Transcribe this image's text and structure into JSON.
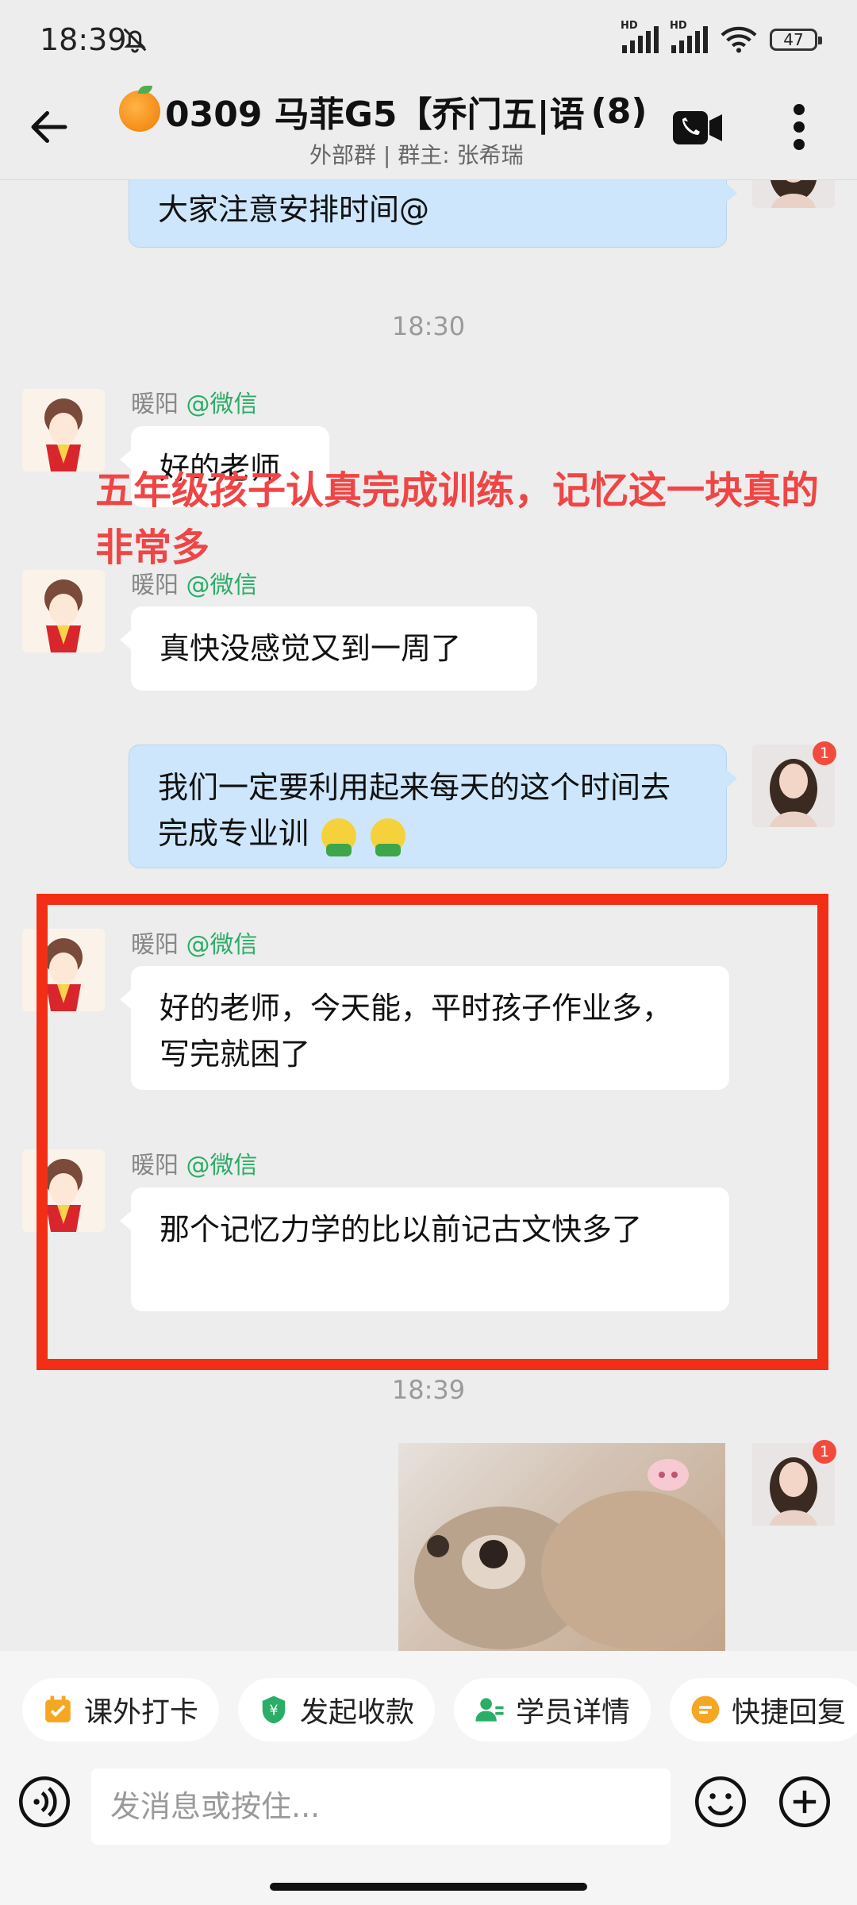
{
  "status_bar": {
    "time": "18:39",
    "battery": "47",
    "network_tag": "HD"
  },
  "header": {
    "title": "0309 马菲G5【乔门五|语",
    "member_count": "(8)",
    "subtitle": "外部群 | 群主: 张希瑞"
  },
  "messages": {
    "m0": {
      "text": "大家注意安排时间@"
    },
    "t1": "18:30",
    "m1": {
      "sender": "暖阳",
      "source": "@微信",
      "text": "好的老师"
    },
    "m2": {
      "sender": "暖阳",
      "source": "@微信",
      "text": "真快没感觉又到一周了"
    },
    "m3": {
      "text": "我们一定要利用起来每天的这个时间去完成专业训"
    },
    "m4": {
      "sender": "暖阳",
      "source": "@微信",
      "text": "好的老师，今天能，平时孩子作业多，写完就困了"
    },
    "m5": {
      "sender": "暖阳",
      "source": "@微信",
      "text": "那个记忆力学的比以前记古文快多了"
    },
    "t2": "18:39",
    "badge": "1"
  },
  "overlay_caption": "五年级孩子认真完成训练，记忆这一块真的非常多",
  "quick_actions": [
    {
      "label": "课外打卡",
      "icon": "checkin-icon",
      "color": "#f5a623"
    },
    {
      "label": "发起收款",
      "icon": "payment-shield-icon",
      "color": "#2aae67"
    },
    {
      "label": "学员详情",
      "icon": "student-icon",
      "color": "#2aae67"
    },
    {
      "label": "快捷回复",
      "icon": "quick-reply-icon",
      "color": "#f5a623"
    }
  ],
  "input": {
    "placeholder": "发消息或按住..."
  },
  "colors": {
    "highlight": "#f22f16",
    "caption": "#f04545",
    "bubble_sent": "#cde6fb",
    "source_green": "#2aae67"
  }
}
